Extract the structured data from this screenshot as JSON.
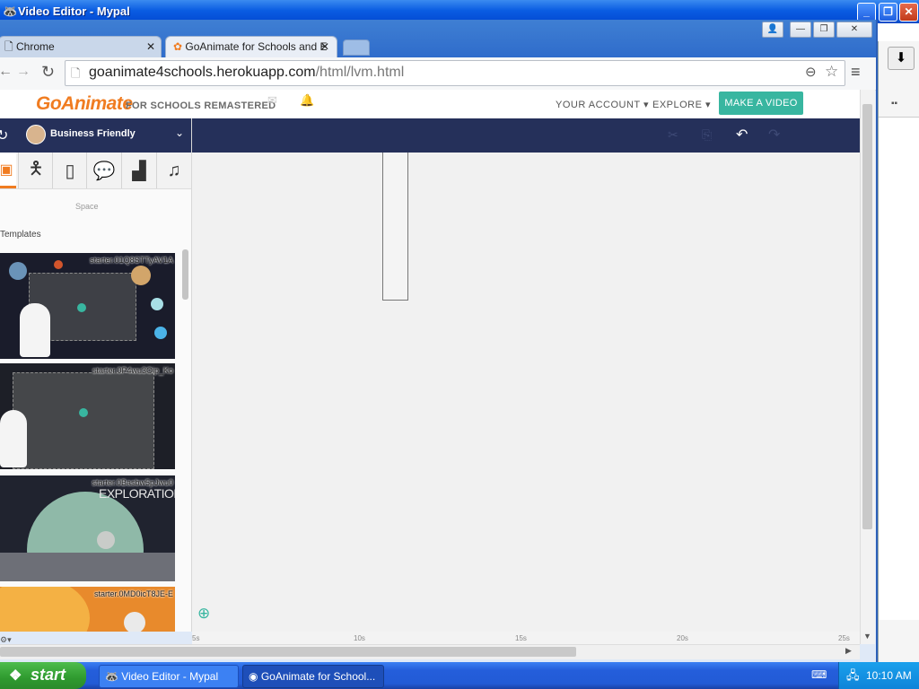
{
  "window": {
    "title": "Video Editor - Mypal"
  },
  "tabs": [
    {
      "label": "Chrome",
      "active": false
    },
    {
      "label": "GoAnimate for Schools and E",
      "active": true
    }
  ],
  "omnibox": {
    "url_host": "goanimate4schools.herokuapp.com",
    "url_path": "/html/lvm.html"
  },
  "site": {
    "logo_go": "GoAnimate",
    "logo_rest": "FOR SCHOOLS REMASTERED",
    "nav": [
      "YOUR ACCOUNT",
      "EXPLORE"
    ],
    "cta": "MAKE A VIDEO"
  },
  "editor": {
    "theme": "Business Friendly",
    "section_space": "Space",
    "section_templates": "Templates",
    "templates": [
      {
        "label": "starter.01Q8STTyAV1A"
      },
      {
        "label": "starter.0P4wu3Oip_Ko"
      },
      {
        "label": "starter.0Basbw5pJwu0",
        "caption": "EXPLORATION"
      },
      {
        "label": "starter.0MD0icT8JE-E"
      }
    ],
    "timeline_ticks": [
      "5s",
      "10s",
      "15s",
      "20s",
      "25s"
    ]
  },
  "taskbar": {
    "start": "start",
    "tasks": [
      "Video Editor - Mypal",
      "GoAnimate for School..."
    ],
    "clock": "10:10 AM"
  },
  "colors": {
    "navy": "#25305a",
    "accent": "#38b6a0",
    "orange": "#f07c21"
  }
}
